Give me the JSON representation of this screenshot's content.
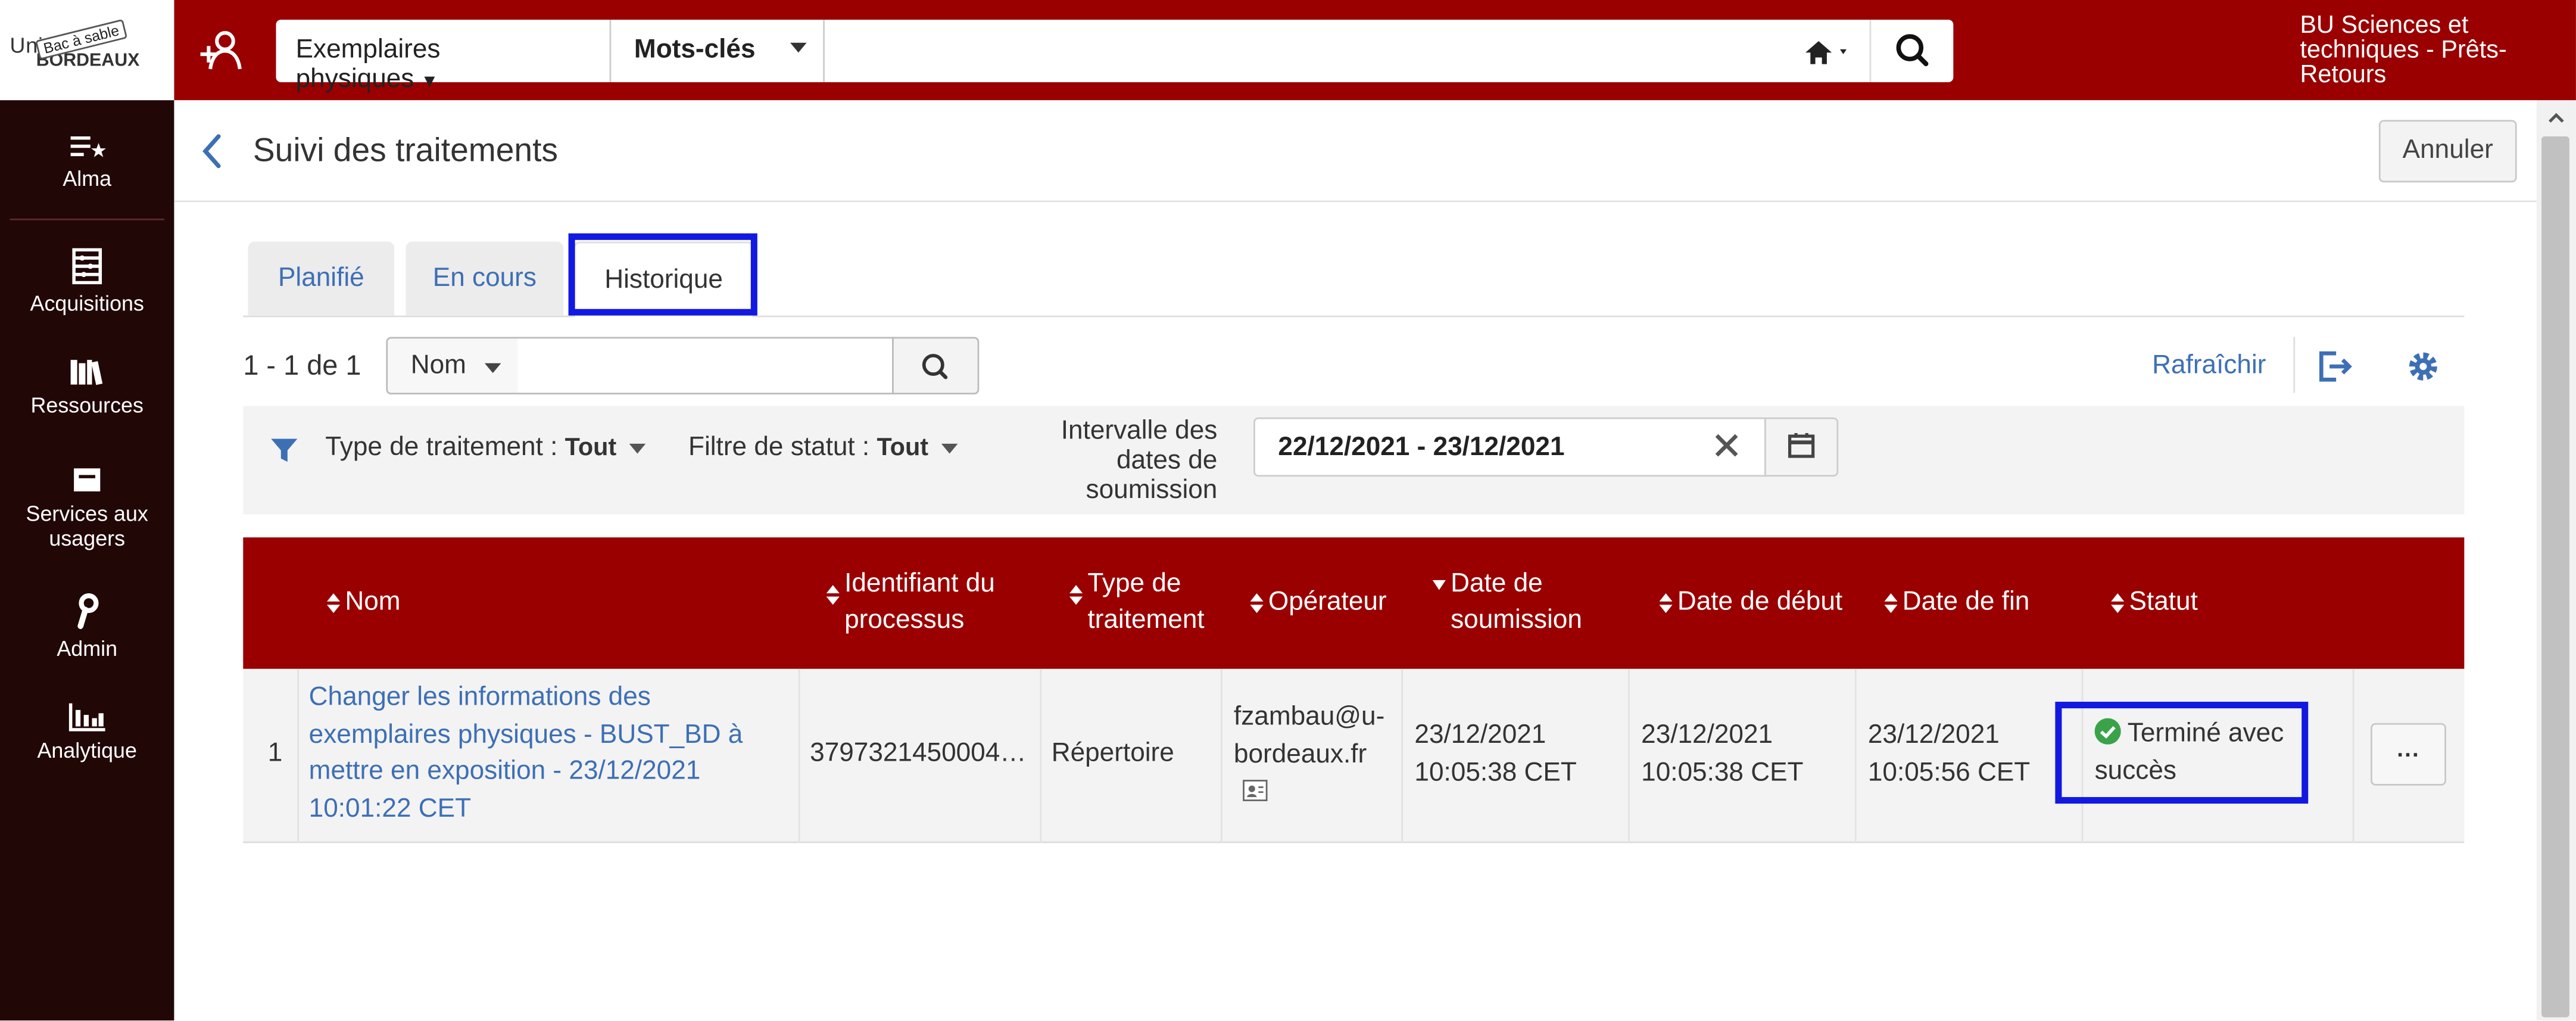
{
  "header": {
    "logo_text": "Univ",
    "logo_sub": "BORDEAUX",
    "sandbox_stamp": "Bac à sable",
    "search_scope": "Exemplaires physiques",
    "search_field": "Mots-clés",
    "search_value": "",
    "institution": "BU Sciences et techniques - Prêts-Retours"
  },
  "nav": {
    "items": [
      {
        "label": "Alma",
        "icon": "alma-icon"
      },
      {
        "label": "Acquisitions",
        "icon": "abacus-icon"
      },
      {
        "label": "Ressources",
        "icon": "books-icon"
      },
      {
        "label": "Services aux usagers",
        "icon": "inbox-icon"
      },
      {
        "label": "Admin",
        "icon": "wrench-icon"
      },
      {
        "label": "Analytique",
        "icon": "bar-chart-icon"
      }
    ]
  },
  "page": {
    "title": "Suivi des traitements",
    "cancel_label": "Annuler"
  },
  "tabs": [
    {
      "label": "Planifié",
      "active": false
    },
    {
      "label": "En cours",
      "active": false
    },
    {
      "label": "Historique",
      "active": true
    }
  ],
  "toolbar": {
    "count": "1 - 1 de 1",
    "search_by": "Nom",
    "search_value": "",
    "refresh_label": "Rafraîchir"
  },
  "filters": {
    "type_label": "Type de traitement :",
    "type_value": "Tout",
    "status_label": "Filtre de statut :",
    "status_value": "Tout",
    "interval_label": "Intervalle des dates de soumission",
    "date_range": "22/12/2021 - 23/12/2021"
  },
  "table": {
    "headers": {
      "name": "Nom",
      "process_id": "Identifiant du processus",
      "type": "Type de traitement",
      "operator": "Opérateur",
      "submission": "Date de soumission",
      "start": "Date de début",
      "end": "Date de fin",
      "status": "Statut"
    },
    "rows": [
      {
        "index": "1",
        "name_lines": [
          "Changer les informations des",
          "exemplaires physiques - BUST_BD à",
          "mettre en exposition - 23/12/2021",
          "10:01:22 CET"
        ],
        "process_id": "3797321450004…",
        "type": "Répertoire",
        "operator_lines": [
          "fzambau@u-",
          "bordeaux.fr"
        ],
        "submission_lines": [
          "23/12/2021",
          "10:05:38 CET"
        ],
        "start_lines": [
          "23/12/2021",
          "10:05:38 CET"
        ],
        "end_lines": [
          "23/12/2021",
          "10:05:56 CET"
        ],
        "status_lines": [
          "Terminé avec",
          "succès"
        ],
        "more_label": "···"
      }
    ]
  },
  "colors": {
    "brand": "#9a0000",
    "nav_bg": "#220707",
    "link": "#3d6fb5",
    "highlight": "#1219e0",
    "success": "#3aa34a"
  }
}
